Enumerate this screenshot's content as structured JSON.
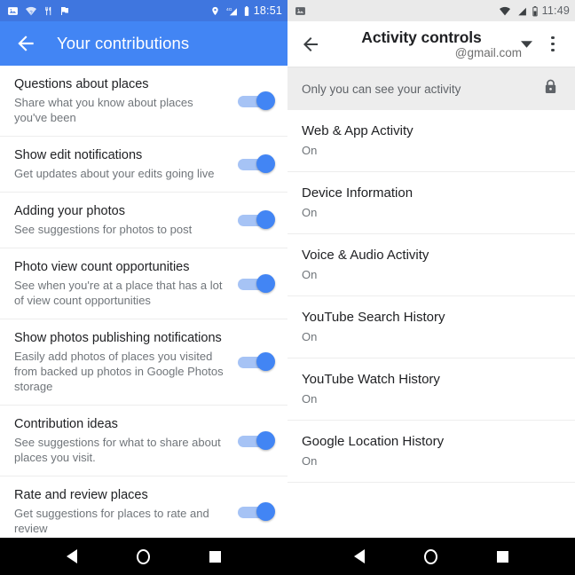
{
  "left": {
    "statusbar": {
      "time": "18:51",
      "left_icons": [
        "screenshot-icon",
        "wifi-unknown-icon",
        "restaurant-icon",
        "flag-icon"
      ],
      "right_icons": [
        "location-pin-icon",
        "signal-4g-icon",
        "battery-icon"
      ],
      "network_label": "4G"
    },
    "appbar": {
      "title": "Your contributions",
      "back_icon": "back-arrow-icon"
    },
    "accent_color": "#4285F4",
    "items": [
      {
        "title": "Questions about places",
        "subtitle": "Share what you know about places you've been",
        "toggle": "on"
      },
      {
        "title": "Show edit notifications",
        "subtitle": "Get updates about your edits going live",
        "toggle": "on"
      },
      {
        "title": "Adding your photos",
        "subtitle": "See suggestions for photos to post",
        "toggle": "on"
      },
      {
        "title": "Photo view count opportunities",
        "subtitle": "See when you're at a place that has a lot of view count opportunities",
        "toggle": "on"
      },
      {
        "title": "Show photos publishing notifications",
        "subtitle": "Easily add photos of places you visited from backed up photos in Google Photos storage",
        "toggle": "on"
      },
      {
        "title": "Contribution ideas",
        "subtitle": "See suggestions for what to share about places you visit.",
        "toggle": "on"
      },
      {
        "title": "Rate and review places",
        "subtitle": "Get suggestions for places to rate and review",
        "toggle": "on"
      }
    ]
  },
  "right": {
    "statusbar": {
      "time": "11:49",
      "left_icons": [
        "screenshot-icon"
      ],
      "right_icons": [
        "wifi-icon",
        "signal-icon",
        "battery-icon"
      ]
    },
    "appbar": {
      "title": "Activity controls",
      "subtitle": "@gmail.com",
      "back_icon": "back-arrow-icon",
      "caret_icon": "chevron-down-icon",
      "more_icon": "overflow-menu-icon"
    },
    "banner": {
      "text": "Only you can see your activity",
      "icon": "lock-icon"
    },
    "items": [
      {
        "title": "Web & App Activity",
        "status": "On"
      },
      {
        "title": "Device Information",
        "status": "On"
      },
      {
        "title": "Voice & Audio Activity",
        "status": "On"
      },
      {
        "title": "YouTube Search History",
        "status": "On"
      },
      {
        "title": "YouTube Watch History",
        "status": "On"
      },
      {
        "title": "Google Location History",
        "status": "On"
      }
    ]
  },
  "navbar": {
    "back_label": "Back",
    "home_label": "Home",
    "recents_label": "Recents"
  }
}
